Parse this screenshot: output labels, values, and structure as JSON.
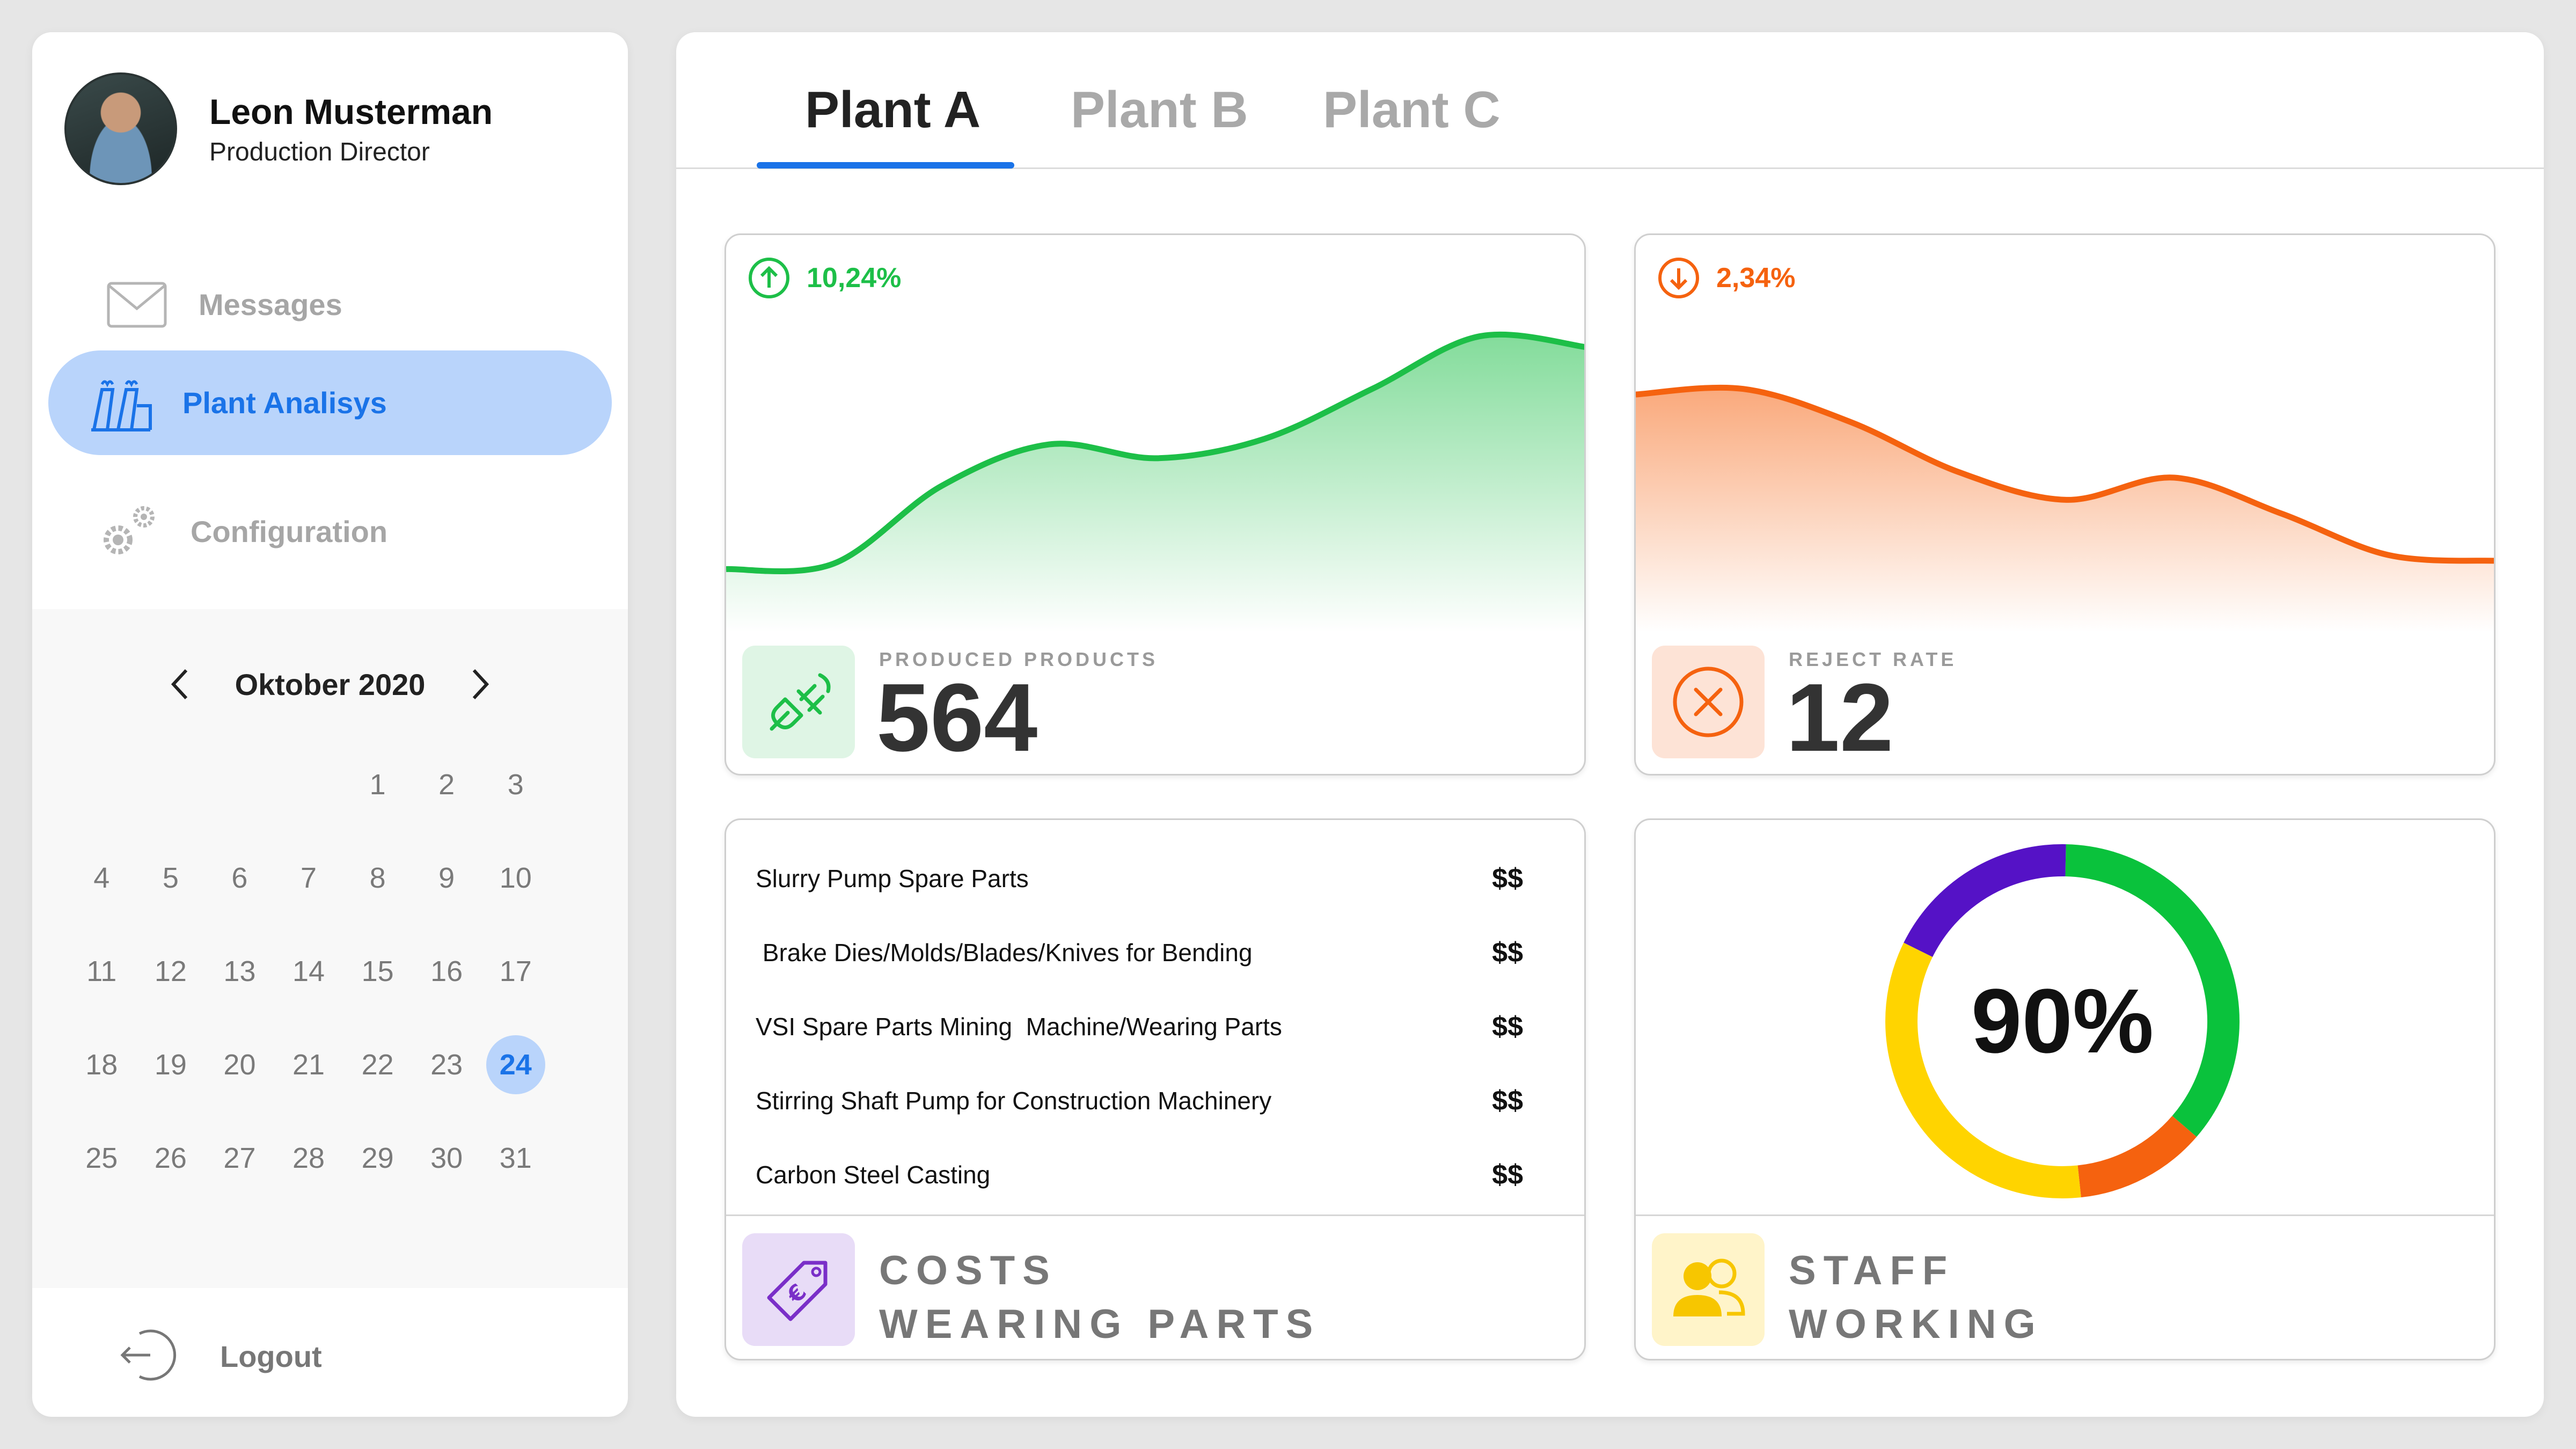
{
  "profile": {
    "name": "Leon Musterman",
    "role": "Production Director"
  },
  "nav": {
    "messages": "Messages",
    "plant_analysis": "Plant Analisys",
    "configuration": "Configuration",
    "logout": "Logout"
  },
  "calendar": {
    "month": "Oktober 2020",
    "selected_day": "24",
    "weeks": [
      [
        "",
        "",
        "",
        "",
        "1",
        "2",
        "3"
      ],
      [
        "4",
        "5",
        "6",
        "7",
        "8",
        "9",
        "10"
      ],
      [
        "11",
        "12",
        "13",
        "14",
        "15",
        "16",
        "17"
      ],
      [
        "18",
        "19",
        "20",
        "21",
        "22",
        "23",
        "24"
      ],
      [
        "25",
        "26",
        "27",
        "28",
        "29",
        "30",
        "31"
      ]
    ]
  },
  "tabs": [
    "Plant A",
    "Plant B",
    "Plant C"
  ],
  "active_tab": "Plant A",
  "produced": {
    "trend": "10,24%",
    "trend_direction": "up",
    "caption": "PRODUCED PRODUCTS",
    "value": "564",
    "color": "#1dbf48"
  },
  "reject": {
    "trend": "2,34%",
    "trend_direction": "down",
    "caption": "REJECT RATE",
    "value": "12",
    "color": "#f5620f"
  },
  "costs": {
    "title_line1": "COSTS",
    "title_line2": "WEARING PARTS",
    "items": [
      {
        "name": "Slurry Pump Spare Parts",
        "price": "$$"
      },
      {
        "name": " Brake Dies/Molds/Blades/Knives for Bending",
        "price": "$$"
      },
      {
        "name": "VSI Spare Parts Mining  Machine/Wearing Parts",
        "price": "$$"
      },
      {
        "name": "Stirring Shaft Pump for Construction Machinery",
        "price": "$$"
      },
      {
        "name": "Carbon Steel Casting",
        "price": "$$"
      }
    ]
  },
  "staff": {
    "title_line1": "STAFF",
    "title_line2": "WORKING",
    "percent": "90%",
    "segments": [
      {
        "color": "#0ac23c",
        "fraction": 0.36
      },
      {
        "color": "#f5620f",
        "fraction": 0.12
      },
      {
        "color": "#ffd400",
        "fraction": 0.34
      },
      {
        "color": "#5512c6",
        "fraction": 0.18
      }
    ]
  },
  "chart_data": [
    {
      "type": "area",
      "series": [
        {
          "values": [
            0.15,
            0.17,
            0.45,
            0.6,
            0.55,
            0.62,
            0.8,
            0.99,
            0.95
          ]
        }
      ],
      "color": "#1dbf48"
    },
    {
      "type": "area",
      "series": [
        {
          "values": [
            0.78,
            0.8,
            0.68,
            0.5,
            0.4,
            0.48,
            0.35,
            0.2,
            0.18
          ]
        }
      ],
      "color": "#f5620f"
    }
  ]
}
